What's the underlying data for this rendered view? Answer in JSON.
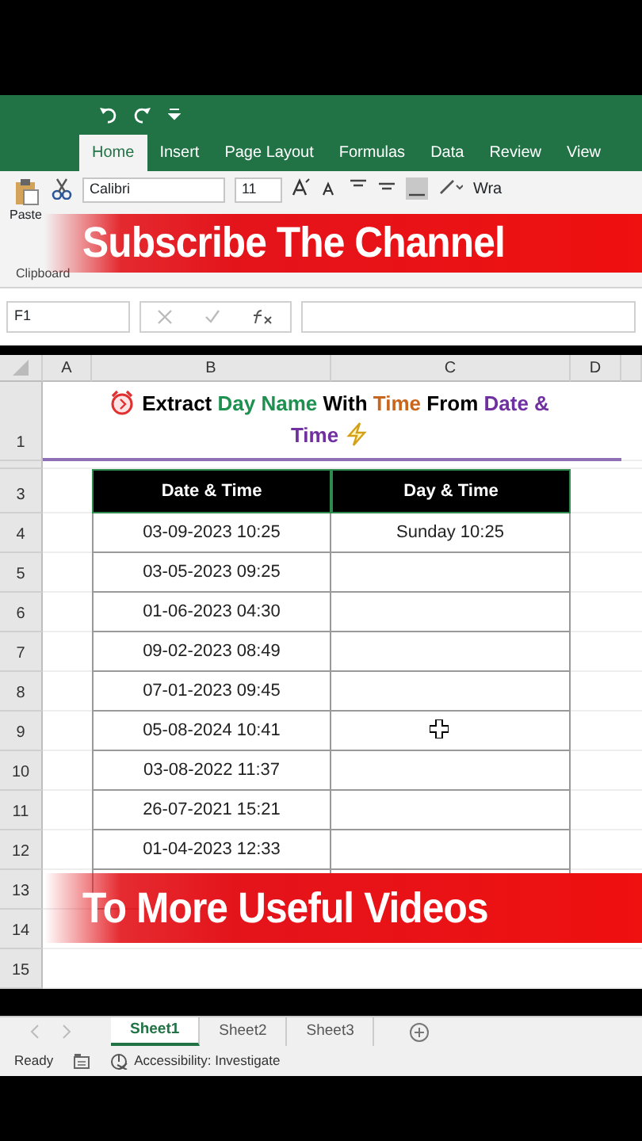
{
  "tabs": [
    {
      "label": "Home",
      "selected": true
    },
    {
      "label": "Insert",
      "selected": false
    },
    {
      "label": "Page Layout",
      "selected": false
    },
    {
      "label": "Formulas",
      "selected": false
    },
    {
      "label": "Data",
      "selected": false
    },
    {
      "label": "Review",
      "selected": false
    },
    {
      "label": "View",
      "selected": false
    }
  ],
  "ribbon": {
    "paste": "Paste",
    "font_name": "Calibri",
    "font_size": "11",
    "wrap": "Wra",
    "groups": [
      "Clipboard"
    ]
  },
  "name_box": "F1",
  "columns": [
    "A",
    "B",
    "C",
    "D"
  ],
  "title": {
    "number": "1",
    "segments": [
      {
        "text": "Extract ",
        "color": "#000000"
      },
      {
        "text": "Day Name",
        "color": "#1e9150"
      },
      {
        "text": " With ",
        "color": "#000000"
      },
      {
        "text": "Time",
        "color": "#c8661e"
      },
      {
        "text": " From ",
        "color": "#000000"
      },
      {
        "text": "Date & Time",
        "color": "#7030a0"
      }
    ]
  },
  "table": {
    "number": "3",
    "columns": [
      "Date & Time",
      "Day & Time"
    ]
  },
  "rows": [
    {
      "number": "4",
      "kind": "data",
      "date": "03-09-2023 10:25",
      "day": "Sunday 10:25"
    },
    {
      "number": "5",
      "kind": "data",
      "date": "03-05-2023 09:25"
    },
    {
      "number": "6",
      "kind": "data",
      "date": "01-06-2023 04:30"
    },
    {
      "number": "7",
      "kind": "data",
      "date": "09-02-2023 08:49"
    },
    {
      "number": "8",
      "kind": "data",
      "date": "07-01-2023 09:45"
    },
    {
      "number": "9",
      "kind": "data",
      "date": "05-08-2024 10:41",
      "cursor": true
    },
    {
      "number": "10",
      "kind": "data",
      "date": "03-08-2022 11:37"
    },
    {
      "number": "11",
      "kind": "data",
      "date": "26-07-2021 15:21"
    },
    {
      "number": "12",
      "kind": "data",
      "date": "01-04-2023 12:33"
    },
    {
      "number": "13",
      "kind": "blank"
    },
    {
      "number": "14",
      "kind": "blank"
    },
    {
      "number": "15",
      "kind": "blank"
    }
  ],
  "sheets": [
    {
      "label": "Sheet1",
      "selected": true
    },
    {
      "label": "Sheet2",
      "selected": false
    },
    {
      "label": "Sheet3",
      "selected": false
    }
  ],
  "status": {
    "ready": "Ready",
    "accessibility": "Accessibility: Investigate"
  },
  "banners": [
    "Subscribe The Channel",
    "To More Useful Videos"
  ]
}
